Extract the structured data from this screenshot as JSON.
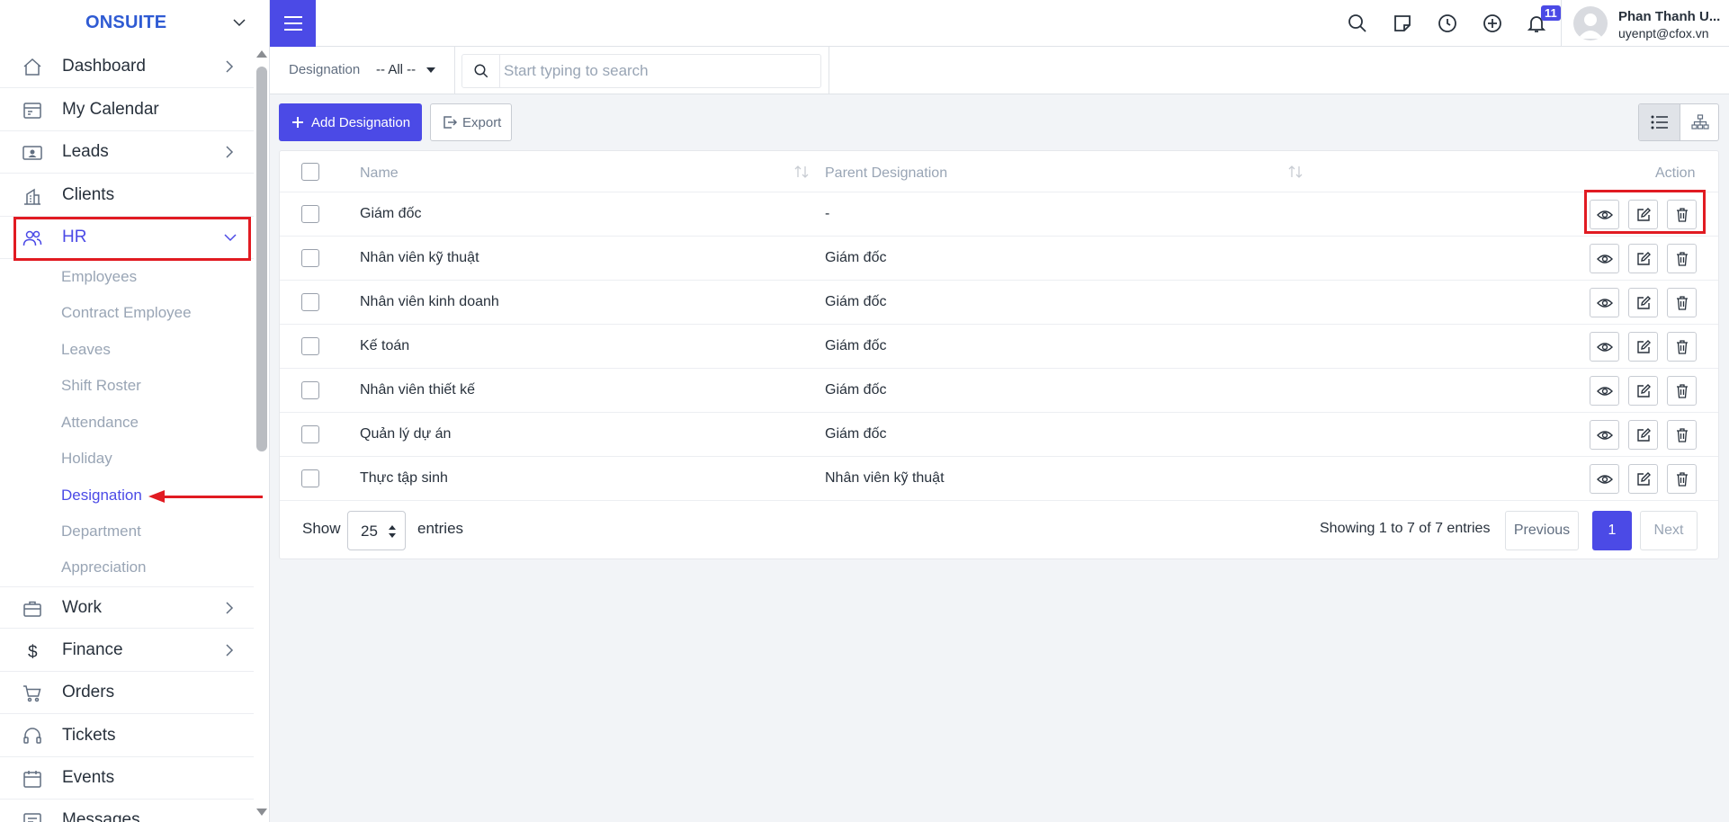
{
  "brand": {
    "name": "ONSUITE"
  },
  "sidebar": {
    "items": [
      {
        "label": "Dashboard",
        "icon": "home-icon",
        "has_arrow": true
      },
      {
        "label": "My Calendar",
        "icon": "calendar-card-icon",
        "has_arrow": false
      },
      {
        "label": "Leads",
        "icon": "person-card-icon",
        "has_arrow": true
      },
      {
        "label": "Clients",
        "icon": "building-icon",
        "has_arrow": false
      },
      {
        "label": "HR",
        "icon": "people-icon",
        "has_arrow": true,
        "expanded": true
      },
      {
        "label": "Work",
        "icon": "briefcase-icon",
        "has_arrow": true
      },
      {
        "label": "Finance",
        "icon": "dollar-icon",
        "has_arrow": true
      },
      {
        "label": "Orders",
        "icon": "cart-icon",
        "has_arrow": false
      },
      {
        "label": "Tickets",
        "icon": "headset-icon",
        "has_arrow": false
      },
      {
        "label": "Events",
        "icon": "calendar-icon",
        "has_arrow": false
      },
      {
        "label": "Messages",
        "icon": "message-icon",
        "has_arrow": false
      }
    ],
    "hr_submenu": [
      "Employees",
      "Contract Employee",
      "Leaves",
      "Shift Roster",
      "Attendance",
      "Holiday",
      "Designation",
      "Department",
      "Appreciation"
    ],
    "current_submenu": "Designation"
  },
  "topbar": {
    "notification_count": "11",
    "user_name": "Phan Thanh U...",
    "user_email": "uyenpt@cfox.vn",
    "icons": [
      "search-icon",
      "sticky-note-icon",
      "clock-icon",
      "plus-circle-icon",
      "bell-icon"
    ]
  },
  "filter": {
    "label": "Designation",
    "selected": "-- All --",
    "search_placeholder": "Start typing to search"
  },
  "actions": {
    "add_label": "Add Designation",
    "export_label": "Export"
  },
  "table": {
    "headers": {
      "name": "Name",
      "parent": "Parent Designation",
      "action": "Action"
    },
    "rows": [
      {
        "name": "Giám đốc",
        "parent": "-"
      },
      {
        "name": "Nhân viên kỹ thuật",
        "parent": "Giám đốc"
      },
      {
        "name": "Nhân viên kinh doanh",
        "parent": "Giám đốc"
      },
      {
        "name": "Kế toán",
        "parent": "Giám đốc"
      },
      {
        "name": "Nhân viên thiết kế",
        "parent": "Giám đốc"
      },
      {
        "name": "Quản lý dự án",
        "parent": "Giám đốc"
      },
      {
        "name": "Thực tập sinh",
        "parent": "Nhân viên kỹ thuật"
      }
    ]
  },
  "footer": {
    "show_label": "Show",
    "page_length": "25",
    "entries_label": "entries",
    "info": "Showing 1 to 7 of 7 entries",
    "prev_label": "Previous",
    "page": "1",
    "next_label": "Next"
  },
  "colors": {
    "accent": "#4b4ae6",
    "brand": "#2f5bd3",
    "annotation": "#e11b22"
  }
}
